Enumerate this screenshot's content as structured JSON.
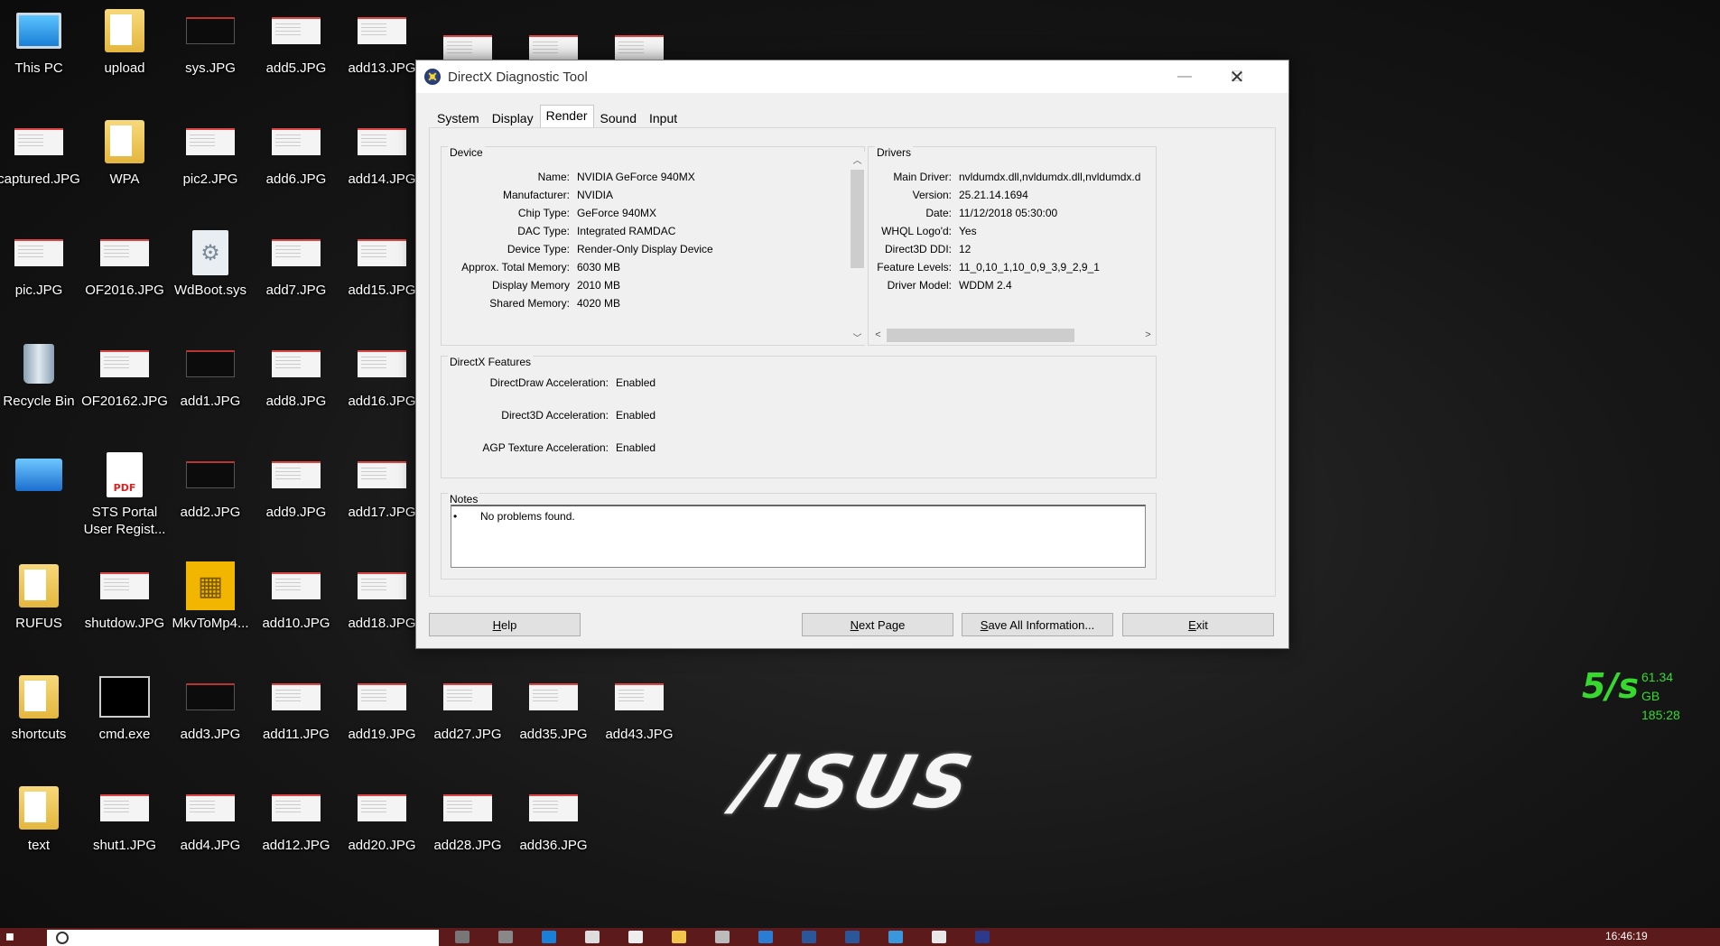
{
  "desktop": {
    "icons": [
      {
        "label": "This PC",
        "kind": "pc"
      },
      {
        "label": "upload",
        "kind": "folder"
      },
      {
        "label": "sys.JPG",
        "kind": "jpg-dark"
      },
      {
        "label": "add5.JPG",
        "kind": "jpg-white"
      },
      {
        "label": "add13.JPG",
        "kind": "jpg-white"
      },
      {
        "label": "",
        "kind": "jpg-white"
      },
      {
        "label": "",
        "kind": "jpg-white"
      },
      {
        "label": "",
        "kind": "jpg-white"
      },
      {
        "label": "captured.JPG",
        "kind": "jpg-white"
      },
      {
        "label": "WPA",
        "kind": "folder"
      },
      {
        "label": "pic2.JPG",
        "kind": "jpg-white"
      },
      {
        "label": "add6.JPG",
        "kind": "jpg-white"
      },
      {
        "label": "add14.JPG",
        "kind": "jpg-white"
      },
      {
        "label": "pic.JPG",
        "kind": "jpg-white"
      },
      {
        "label": "OF2016.JPG",
        "kind": "jpg-white"
      },
      {
        "label": "WdBoot.sys",
        "kind": "sys"
      },
      {
        "label": "add7.JPG",
        "kind": "jpg-white"
      },
      {
        "label": "add15.JPG",
        "kind": "jpg-white"
      },
      {
        "label": "Recycle Bin",
        "kind": "bin"
      },
      {
        "label": "OF20162.JPG",
        "kind": "jpg-white"
      },
      {
        "label": "add1.JPG",
        "kind": "jpg-dark"
      },
      {
        "label": "add8.JPG",
        "kind": "jpg-white"
      },
      {
        "label": "add16.JPG",
        "kind": "jpg-white"
      },
      {
        "label": "",
        "kind": "cp"
      },
      {
        "label": "STS Portal User Regist...",
        "kind": "pdf"
      },
      {
        "label": "add2.JPG",
        "kind": "jpg-dark"
      },
      {
        "label": "add9.JPG",
        "kind": "jpg-white"
      },
      {
        "label": "add17.JPG",
        "kind": "jpg-white"
      },
      {
        "label": "RUFUS",
        "kind": "folder"
      },
      {
        "label": "shutdow.JPG",
        "kind": "jpg-white"
      },
      {
        "label": "MkvToMp4...",
        "kind": "mkv"
      },
      {
        "label": "add10.JPG",
        "kind": "jpg-white"
      },
      {
        "label": "add18.JPG",
        "kind": "jpg-white"
      },
      {
        "label": "shortcuts",
        "kind": "folder"
      },
      {
        "label": "cmd.exe",
        "kind": "cmd"
      },
      {
        "label": "add3.JPG",
        "kind": "jpg-dark"
      },
      {
        "label": "add11.JPG",
        "kind": "jpg-white"
      },
      {
        "label": "add19.JPG",
        "kind": "jpg-white"
      },
      {
        "label": "add27.JPG",
        "kind": "jpg-white"
      },
      {
        "label": "add35.JPG",
        "kind": "jpg-white"
      },
      {
        "label": "add43.JPG",
        "kind": "jpg-white"
      },
      {
        "label": "text",
        "kind": "folder"
      },
      {
        "label": "shut1.JPG",
        "kind": "jpg-white"
      },
      {
        "label": "add4.JPG",
        "kind": "jpg-white"
      },
      {
        "label": "add12.JPG",
        "kind": "jpg-white"
      },
      {
        "label": "add20.JPG",
        "kind": "jpg-white"
      },
      {
        "label": "add28.JPG",
        "kind": "jpg-white"
      },
      {
        "label": "add36.JPG",
        "kind": "jpg-white"
      }
    ],
    "brand_logo": "/ISUS",
    "net_widget": {
      "speed": "5/s",
      "total": "61.34 GB",
      "secondary": "185:28"
    }
  },
  "dialog": {
    "title": "DirectX Diagnostic Tool",
    "tabs": [
      "System",
      "Display",
      "Render",
      "Sound",
      "Input"
    ],
    "active_tab": "Render",
    "device": {
      "title": "Device",
      "rows": [
        {
          "key": "Name:",
          "value": "NVIDIA GeForce 940MX"
        },
        {
          "key": "Manufacturer:",
          "value": "NVIDIA"
        },
        {
          "key": "Chip Type:",
          "value": "GeForce 940MX"
        },
        {
          "key": "DAC Type:",
          "value": "Integrated RAMDAC"
        },
        {
          "key": "Device Type:",
          "value": "Render-Only Display Device"
        },
        {
          "key": "Approx. Total Memory:",
          "value": "6030 MB"
        },
        {
          "key": "Display Memory",
          "value": "2010 MB"
        },
        {
          "key": "Shared Memory:",
          "value": "4020 MB"
        }
      ]
    },
    "drivers": {
      "title": "Drivers",
      "rows": [
        {
          "key": "Main Driver:",
          "value": "nvldumdx.dll,nvldumdx.dll,nvldumdx.d"
        },
        {
          "key": "Version:",
          "value": "25.21.14.1694"
        },
        {
          "key": "Date:",
          "value": "11/12/2018 05:30:00"
        },
        {
          "key": "WHQL Logo'd:",
          "value": "Yes"
        },
        {
          "key": "Direct3D DDI:",
          "value": "12"
        },
        {
          "key": "Feature Levels:",
          "value": "11_0,10_1,10_0,9_3,9_2,9_1"
        },
        {
          "key": "Driver Model:",
          "value": "WDDM 2.4"
        }
      ]
    },
    "features": {
      "title": "DirectX Features",
      "rows": [
        {
          "key": "DirectDraw Acceleration:",
          "value": "Enabled"
        },
        {
          "key": "Direct3D Acceleration:",
          "value": "Enabled"
        },
        {
          "key": "AGP Texture Acceleration:",
          "value": "Enabled"
        }
      ]
    },
    "notes": {
      "title": "Notes",
      "bullet": "•",
      "items": [
        "No problems found."
      ]
    },
    "buttons": {
      "help": {
        "underlined": "H",
        "rest": "elp"
      },
      "next": {
        "underlined": "N",
        "rest": "ext Page"
      },
      "save": {
        "underlined": "S",
        "rest": "ave All Information..."
      },
      "exit": {
        "underlined": "E",
        "rest": "xit"
      }
    }
  },
  "taskbar": {
    "clock": "16:46:19"
  }
}
